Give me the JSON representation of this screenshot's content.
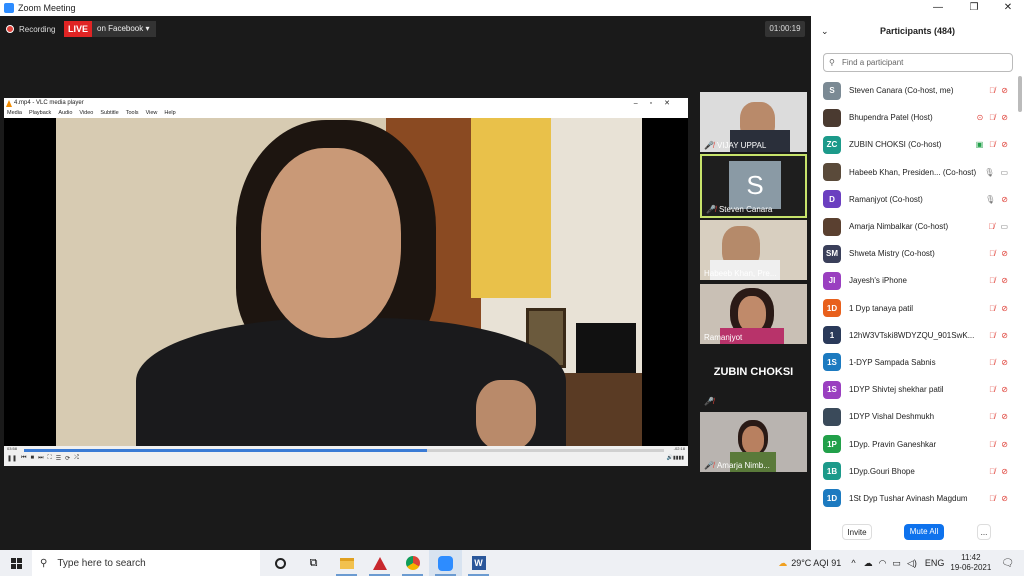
{
  "window": {
    "title": "Zoom Meeting"
  },
  "meeting": {
    "recording_label": "Recording",
    "live_label": "LIVE",
    "stream_target": "on Facebook ▾",
    "elapsed": "01:00:19"
  },
  "vlc": {
    "title": "4.mp4 - VLC media player",
    "menu": [
      "Media",
      "Playback",
      "Audio",
      "Video",
      "Subtitle",
      "Tools",
      "View",
      "Help"
    ],
    "time_left": "03:58",
    "time_right": "-02:18",
    "progress": 0.63
  },
  "gallery": {
    "tiles": [
      {
        "name": "VIJAY UPPAL"
      },
      {
        "name": "Steven Canara",
        "initial": "S"
      },
      {
        "name": "Habeeb Khan, Pre..."
      },
      {
        "name": "Ramanjyot"
      },
      {
        "name": "ZUBIN CHOKSI"
      },
      {
        "name": "Amarja Nimb..."
      }
    ]
  },
  "participants": {
    "header": "Participants (484)",
    "search_placeholder": "Find a participant",
    "list": [
      {
        "initials": "S",
        "name": "Steven Canara (Co-host, me)",
        "color": "#7b8a94"
      },
      {
        "initials": "",
        "name": "Bhupendra Patel (Host)",
        "color": "#4a3a30"
      },
      {
        "initials": "ZC",
        "name": "ZUBIN CHOKSI (Co-host)",
        "color": "#1c9a8a"
      },
      {
        "initials": "",
        "name": "Habeeb Khan, Presiden... (Co-host)",
        "color": "#5a4a3a"
      },
      {
        "initials": "D",
        "name": "Ramanjyot (Co-host)",
        "color": "#6b3fc0"
      },
      {
        "initials": "",
        "name": "Amarja Nimbalkar (Co-host)",
        "color": "#5a4030"
      },
      {
        "initials": "SM",
        "name": "Shweta Mistry (Co-host)",
        "color": "#3a3f5a"
      },
      {
        "initials": "JI",
        "name": " Jayesh's iPhone",
        "color": "#9a3fc0"
      },
      {
        "initials": "1D",
        "name": "1 Dyp tanaya patil",
        "color": "#e8601c"
      },
      {
        "initials": "1",
        "name": "12hW3VTski8WDYZQU_901SwK...",
        "color": "#2a3a5a"
      },
      {
        "initials": "1S",
        "name": "1-DYP Sampada Sabnis",
        "color": "#1c7ac0"
      },
      {
        "initials": "1S",
        "name": "1DYP Shivtej shekhar patil",
        "color": "#9a3fc0"
      },
      {
        "initials": "",
        "name": "1DYP Vishal Deshmukh",
        "color": "#3a4a5a"
      },
      {
        "initials": "1P",
        "name": "1Dyp. Pravin Ganeshkar",
        "color": "#22a04a"
      },
      {
        "initials": "1B",
        "name": "1Dyp.Gouri Bhope",
        "color": "#1c9a8a"
      },
      {
        "initials": "1D",
        "name": "1St Dyp Tushar Avinash Magdum",
        "color": "#1c7ac0"
      }
    ],
    "invite_label": "Invite",
    "mute_all_label": "Mute All",
    "more_label": "..."
  },
  "taskbar": {
    "search_placeholder": "Type here to search",
    "weather": "29°C  AQI 91",
    "language": "ENG",
    "time": "11:42",
    "date": "19-06-2021"
  }
}
